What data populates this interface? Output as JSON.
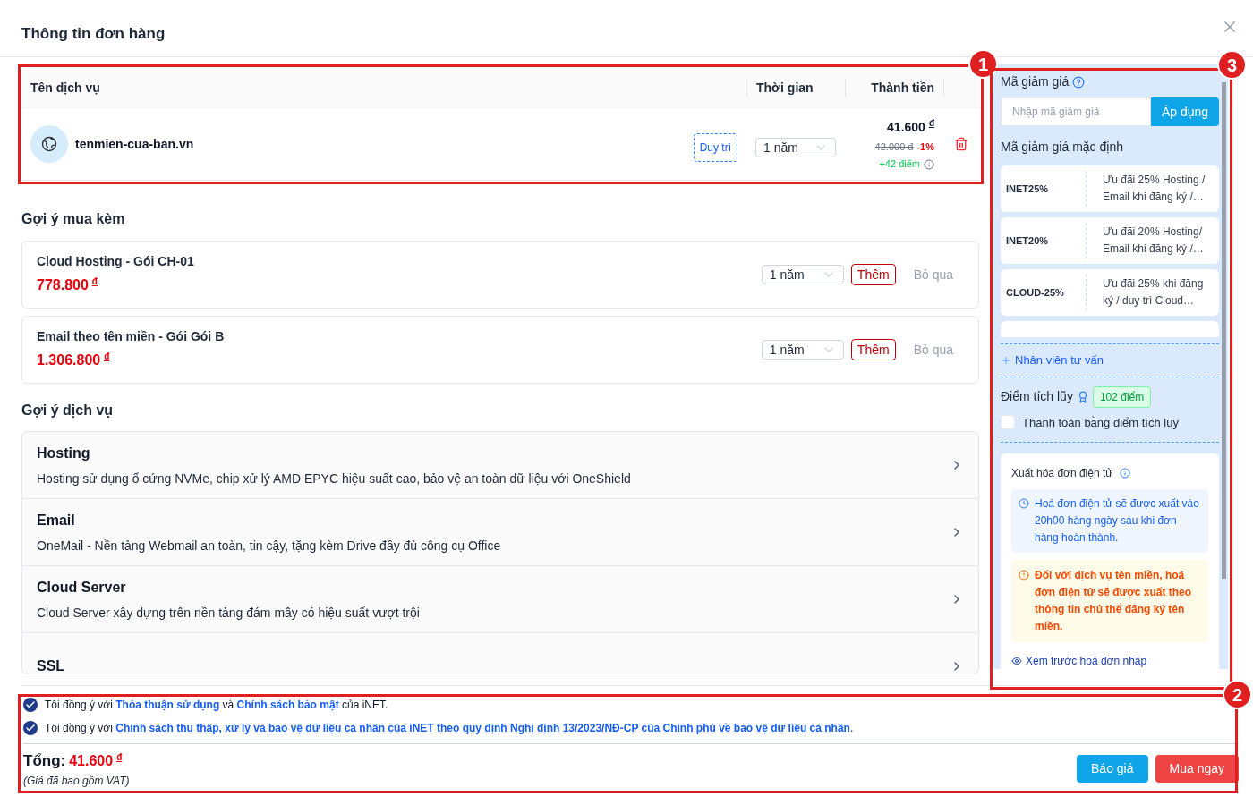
{
  "title": "Thông tin đơn hàng",
  "order_table": {
    "columns": [
      "Tên dịch vụ",
      "Thời gian",
      "Thành tiền"
    ],
    "rows": [
      {
        "name": "tenmien-cua-ban.vn",
        "action": "Duy trì",
        "period": "1 năm",
        "price": "41.600",
        "currency": "đ",
        "old_price": "42.000 đ",
        "discount": "-1%",
        "points": "+42 điểm"
      }
    ]
  },
  "suggest_buy": {
    "heading": "Gợi ý mua kèm",
    "items": [
      {
        "name": "Cloud Hosting - Gói CH-01",
        "price": "778.800",
        "currency": "đ",
        "period": "1 năm",
        "add": "Thêm",
        "skip": "Bỏ qua"
      },
      {
        "name": "Email theo tên miền - Gói Gói B",
        "price": "1.306.800",
        "currency": "đ",
        "period": "1 năm",
        "add": "Thêm",
        "skip": "Bỏ qua"
      }
    ]
  },
  "suggest_services": {
    "heading": "Gợi ý dịch vụ",
    "items": [
      {
        "title": "Hosting",
        "description": "Hosting sử dụng ổ cứng NVMe, chip xử lý AMD EPYC hiệu suất cao, bảo vệ an toàn dữ liệu với OneShield"
      },
      {
        "title": "Email",
        "description": "OneMail - Nền tảng Webmail an toàn, tin cậy, tặng kèm Drive đầy đủ công cụ Office"
      },
      {
        "title": "Cloud Server",
        "description": "Cloud Server xây dựng trên nền tảng đám mây có hiệu suất vượt trội"
      },
      {
        "title": "SSL"
      }
    ]
  },
  "sidebar": {
    "coupon_label": "Mã giảm giá",
    "coupon_placeholder": "Nhập mã giảm giá",
    "apply": "Áp dụng",
    "default_label": "Mã giảm giá mặc định",
    "coupons": [
      {
        "code": "INET25%",
        "description": "Ưu đãi 25% Hosting / Email khi đăng ký /…"
      },
      {
        "code": "INET20%",
        "description": "Ưu đãi 20% Hosting/ Email khi đăng ký /…"
      },
      {
        "code": "CLOUD-25%",
        "description": "Ưu đãi 25% khi đăng ký / duy trì Cloud…"
      }
    ],
    "consultant": "Nhân viên tư vấn",
    "points_label": "Điểm tích lũy",
    "points_badge": "102 điểm",
    "pay_with_points": {
      "label": "Thanh toán bằng điểm tích lũy",
      "checked": false
    },
    "invoice": {
      "title": "Xuất hóa đơn điện tử",
      "info": "Hoá đơn điện tử sẽ được xuất vào 20h00 hàng ngày sau khi đơn hàng hoàn thành.",
      "warning": "Đối với dịch vụ tên miền, hoá đơn điện tử sẽ được xuất theo thông tin chủ thể đăng ký tên miền.",
      "preview": "Xem trước hoá đơn nháp"
    }
  },
  "agreements": [
    {
      "checked": true,
      "parts": [
        {
          "kind": "text",
          "text": "Tôi đồng ý với "
        },
        {
          "kind": "link",
          "text": "Thỏa thuận sử dụng"
        },
        {
          "kind": "text",
          "text": " và "
        },
        {
          "kind": "link",
          "text": "Chính sách bảo mật"
        },
        {
          "kind": "text",
          "text": " của iNET."
        }
      ]
    },
    {
      "checked": true,
      "parts": [
        {
          "kind": "text",
          "text": "Tôi đồng ý với "
        },
        {
          "kind": "link",
          "text": "Chính sách thu thập, xử lý và bảo vệ dữ liệu cá nhân của iNET theo quy định Nghị định 13/2023/NĐ-CP của Chính phủ về bảo vệ dữ liệu cá nhân"
        },
        {
          "kind": "text",
          "text": "."
        }
      ]
    }
  ],
  "total": {
    "label": "Tổng:",
    "amount": "41.600",
    "currency": "đ",
    "note": "(Giá đã bao gồm VAT)"
  },
  "buttons": [
    {
      "label": "Báo giá",
      "kind": "quote"
    },
    {
      "label": "Mua ngay",
      "kind": "buy"
    }
  ],
  "annotations": [
    {
      "number": "1",
      "kind": "order"
    },
    {
      "number": "3",
      "kind": "sidebar"
    },
    {
      "number": "2",
      "kind": "footer"
    }
  ]
}
